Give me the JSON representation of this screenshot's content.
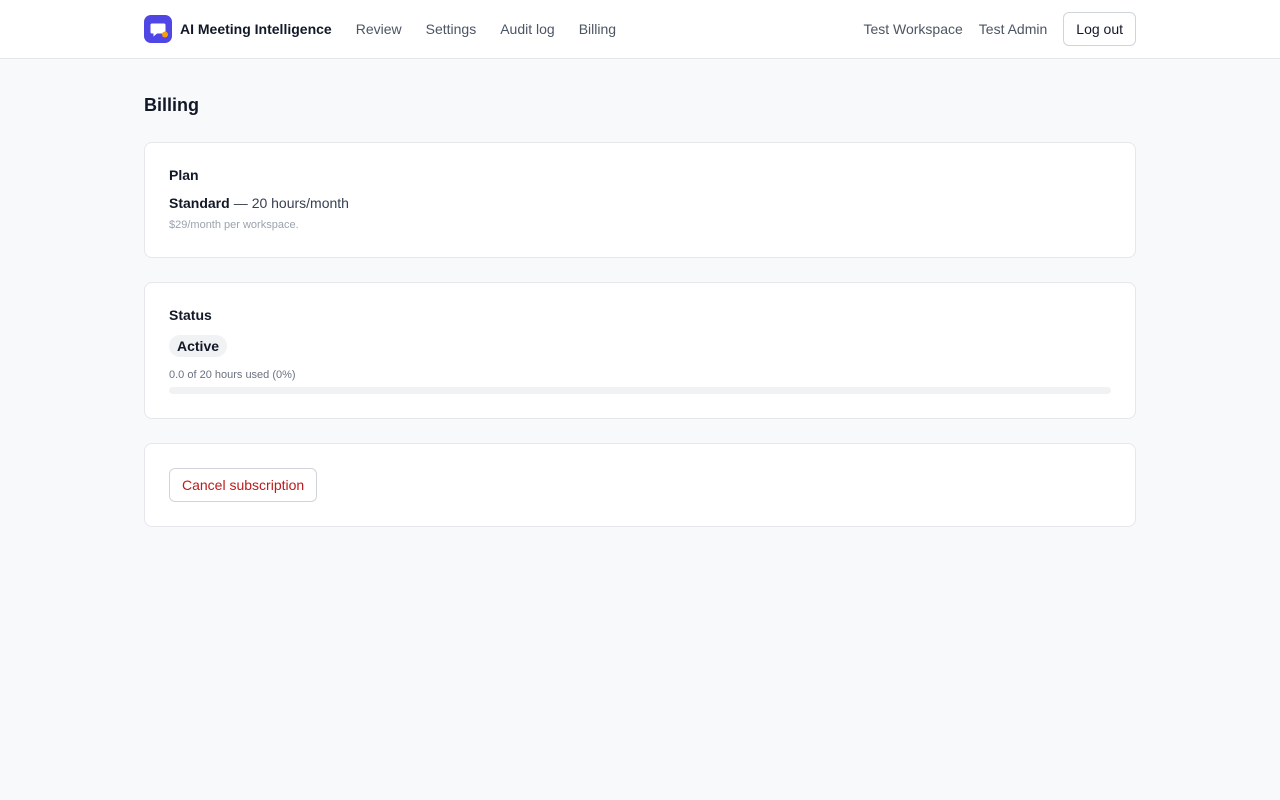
{
  "header": {
    "brand": "AI Meeting Intelligence",
    "logo_icon": "chat-bubble-icon",
    "nav": [
      {
        "label": "Review"
      },
      {
        "label": "Settings"
      },
      {
        "label": "Audit log"
      },
      {
        "label": "Billing"
      }
    ],
    "workspace": "Test Workspace",
    "user": "Test Admin",
    "logout_label": "Log out"
  },
  "page": {
    "title": "Billing"
  },
  "plan": {
    "label": "Plan",
    "name": "Standard",
    "separator": "—",
    "quota": "20 hours/month",
    "price": "$29/month per workspace."
  },
  "status": {
    "label": "Status",
    "badge": "Active",
    "usage_text": "0.0 of 20 hours used (0%)",
    "usage_fraction": 0
  },
  "actions": {
    "cancel_label": "Cancel subscription"
  },
  "colors": {
    "accent": "#4f46e5",
    "logo_dot": "#f59e0b",
    "danger": "#b91c1c",
    "background": "#f8f9fb"
  }
}
